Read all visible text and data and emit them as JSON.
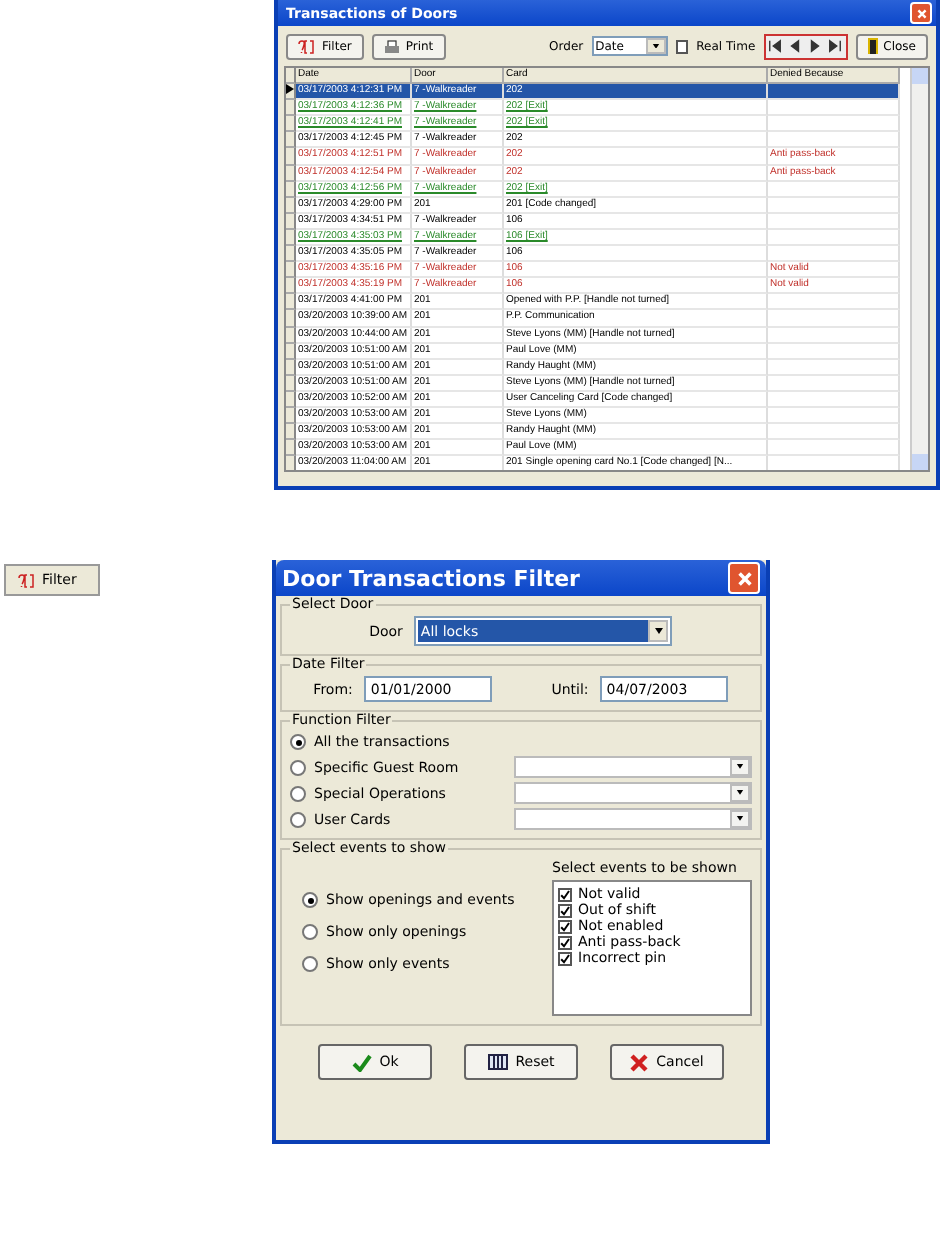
{
  "transactions_window": {
    "title": "Transactions of Doors",
    "toolbar": {
      "filter_button": "Filter",
      "print_button": "Print",
      "order_label": "Order",
      "order_value": "Date",
      "real_time": {
        "label": "Real Time",
        "checked": false
      },
      "close_button": "Close"
    },
    "table": {
      "columns": [
        "Date",
        "Door",
        "Card",
        "Denied Because"
      ],
      "rows": [
        {
          "date": "03/17/2003 4:12:31 PM",
          "door": "7 -Walkreader",
          "card": "202",
          "denied": "",
          "kind": "normal",
          "selected": true
        },
        {
          "date": "03/17/2003 4:12:36 PM",
          "door": "7 -Walkreader",
          "card": "202 [Exit]",
          "denied": "",
          "kind": "exit",
          "selected": false
        },
        {
          "date": "03/17/2003 4:12:41 PM",
          "door": "7 -Walkreader",
          "card": "202 [Exit]",
          "denied": "",
          "kind": "exit",
          "selected": false
        },
        {
          "date": "03/17/2003 4:12:45 PM",
          "door": "7 -Walkreader",
          "card": "202",
          "denied": "",
          "kind": "normal",
          "selected": false
        },
        {
          "date": "03/17/2003 4:12:51 PM",
          "door": "7 -Walkreader",
          "card": "202",
          "denied": "Anti pass-back",
          "kind": "denied",
          "selected": false
        },
        {
          "date": "03/17/2003 4:12:54 PM",
          "door": "7 -Walkreader",
          "card": "202",
          "denied": "Anti pass-back",
          "kind": "denied",
          "selected": false
        },
        {
          "date": "03/17/2003 4:12:56 PM",
          "door": "7 -Walkreader",
          "card": "202 [Exit]",
          "denied": "",
          "kind": "exit",
          "selected": false
        },
        {
          "date": "03/17/2003 4:29:00 PM",
          "door": "201",
          "card": "201 [Code changed]",
          "denied": "",
          "kind": "normal",
          "selected": false
        },
        {
          "date": "03/17/2003 4:34:51 PM",
          "door": "7 -Walkreader",
          "card": "106",
          "denied": "",
          "kind": "normal",
          "selected": false
        },
        {
          "date": "03/17/2003 4:35:03 PM",
          "door": "7 -Walkreader",
          "card": "106 [Exit]",
          "denied": "",
          "kind": "exit",
          "selected": false
        },
        {
          "date": "03/17/2003 4:35:05 PM",
          "door": "7 -Walkreader",
          "card": "106",
          "denied": "",
          "kind": "normal",
          "selected": false
        },
        {
          "date": "03/17/2003 4:35:16 PM",
          "door": "7 -Walkreader",
          "card": "106",
          "denied": "Not valid",
          "kind": "denied",
          "selected": false
        },
        {
          "date": "03/17/2003 4:35:19 PM",
          "door": "7 -Walkreader",
          "card": "106",
          "denied": "Not valid",
          "kind": "denied",
          "selected": false
        },
        {
          "date": "03/17/2003 4:41:00 PM",
          "door": "201",
          "card": "Opened with P.P. [Handle not turned]",
          "denied": "",
          "kind": "normal",
          "selected": false
        },
        {
          "date": "03/20/2003 10:39:00 AM",
          "door": "201",
          "card": "P.P. Communication",
          "denied": "",
          "kind": "normal",
          "selected": false
        },
        {
          "date": "03/20/2003 10:44:00 AM",
          "door": "201",
          "card": "Steve Lyons (MM) [Handle not turned]",
          "denied": "",
          "kind": "normal",
          "selected": false
        },
        {
          "date": "03/20/2003 10:51:00 AM",
          "door": "201",
          "card": "Paul Love (MM)",
          "denied": "",
          "kind": "normal",
          "selected": false
        },
        {
          "date": "03/20/2003 10:51:00 AM",
          "door": "201",
          "card": "Randy Haught (MM)",
          "denied": "",
          "kind": "normal",
          "selected": false
        },
        {
          "date": "03/20/2003 10:51:00 AM",
          "door": "201",
          "card": "Steve Lyons (MM) [Handle not turned]",
          "denied": "",
          "kind": "normal",
          "selected": false
        },
        {
          "date": "03/20/2003 10:52:00 AM",
          "door": "201",
          "card": "User Canceling Card [Code changed]",
          "denied": "",
          "kind": "normal",
          "selected": false
        },
        {
          "date": "03/20/2003 10:53:00 AM",
          "door": "201",
          "card": "Steve Lyons (MM)",
          "denied": "",
          "kind": "normal",
          "selected": false
        },
        {
          "date": "03/20/2003 10:53:00 AM",
          "door": "201",
          "card": "Randy Haught (MM)",
          "denied": "",
          "kind": "normal",
          "selected": false
        },
        {
          "date": "03/20/2003 10:53:00 AM",
          "door": "201",
          "card": "Paul Love (MM)",
          "denied": "",
          "kind": "normal",
          "selected": false
        },
        {
          "date": "03/20/2003 11:04:00 AM",
          "door": "201",
          "card": "201 Single opening card No.1 [Code changed] [N...",
          "denied": "",
          "kind": "normal",
          "selected": false
        }
      ]
    }
  },
  "standalone_filter_button": "Filter",
  "filter_dialog": {
    "title": "Door Transactions Filter",
    "select_door": {
      "legend": "Select Door",
      "label": "Door",
      "value": "All locks"
    },
    "date_filter": {
      "legend": "Date Filter",
      "from_label": "From:",
      "from_value": "01/01/2000",
      "until_label": "Until:",
      "until_value": "04/07/2003"
    },
    "function_filter": {
      "legend": "Function Filter",
      "options": [
        {
          "label": "All the transactions",
          "selected": true,
          "kind": "plain"
        },
        {
          "label": "Specific Guest Room",
          "selected": false,
          "kind": "combo"
        },
        {
          "label": "Special Operations",
          "selected": false,
          "kind": "combo"
        },
        {
          "label": "User Cards",
          "selected": false,
          "kind": "combo"
        }
      ]
    },
    "events": {
      "legend": "Select events to show",
      "options": [
        {
          "label": "Show openings and events",
          "selected": true
        },
        {
          "label": "Show only openings",
          "selected": false
        },
        {
          "label": "Show only events",
          "selected": false
        }
      ],
      "list_label": "Select events to be shown",
      "items": [
        {
          "label": "Not valid",
          "checked": true
        },
        {
          "label": "Out of shift",
          "checked": true
        },
        {
          "label": "Not enabled",
          "checked": true
        },
        {
          "label": "Anti pass-back",
          "checked": true
        },
        {
          "label": "Incorrect pin",
          "checked": true
        }
      ]
    },
    "buttons": [
      {
        "label": "Ok",
        "kind": "ok"
      },
      {
        "label": "Reset",
        "kind": "reset"
      },
      {
        "label": "Cancel",
        "kind": "cancel"
      }
    ]
  }
}
